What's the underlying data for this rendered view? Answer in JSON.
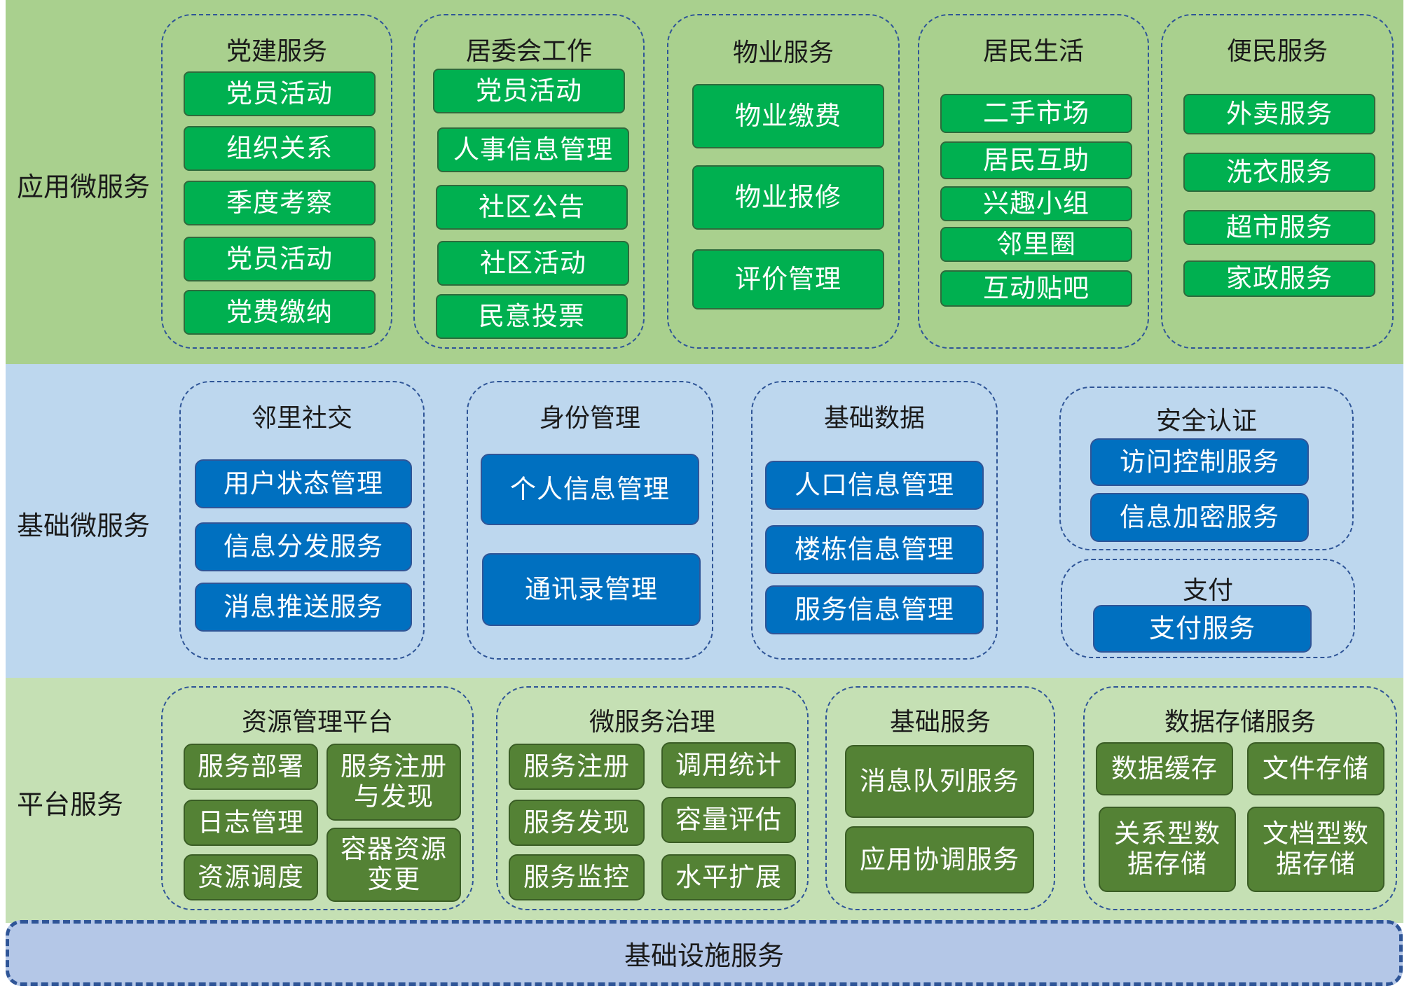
{
  "layers": {
    "app": "应用微服务",
    "base": "基础微服务",
    "platform": "平台服务",
    "infra": "基础设施服务"
  },
  "app_groups": [
    {
      "title": "党建服务",
      "items": [
        "党员活动",
        "组织关系",
        "季度考察",
        "党员活动",
        "党费缴纳"
      ]
    },
    {
      "title": "居委会工作",
      "items": [
        "党员活动",
        "人事信息管理",
        "社区公告",
        "社区活动",
        "民意投票"
      ]
    },
    {
      "title": "物业服务",
      "items": [
        "物业缴费",
        "物业报修",
        "评价管理"
      ]
    },
    {
      "title": "居民生活",
      "items": [
        "二手市场",
        "居民互助",
        "兴趣小组",
        "邻里圈",
        "互动贴吧"
      ]
    },
    {
      "title": "便民服务",
      "items": [
        "外卖服务",
        "洗衣服务",
        "超市服务",
        "家政服务"
      ]
    }
  ],
  "base_groups": [
    {
      "title": "邻里社交",
      "items": [
        "用户状态管理",
        "信息分发服务",
        "消息推送服务"
      ]
    },
    {
      "title": "身份管理",
      "items": [
        "个人信息管理",
        "通讯录管理"
      ]
    },
    {
      "title": "基础数据",
      "items": [
        "人口信息管理",
        "楼栋信息管理",
        "服务信息管理"
      ]
    },
    {
      "title": "安全认证",
      "items": [
        "访问控制服务",
        "信息加密服务"
      ]
    },
    {
      "title": "支付",
      "items": [
        "支付服务"
      ]
    }
  ],
  "platform_groups": [
    {
      "title": "资源管理平台",
      "items": [
        "服务部署",
        "日志管理",
        "资源调度",
        "服务注册\n与发现",
        "容器资源\n变更"
      ]
    },
    {
      "title": "微服务治理",
      "items": [
        "服务注册",
        "服务发现",
        "服务监控",
        "调用统计",
        "容量评估",
        "水平扩展"
      ]
    },
    {
      "title": "基础服务",
      "items": [
        "消息队列服务",
        "应用协调服务"
      ]
    },
    {
      "title": "数据存储服务",
      "items": [
        "数据缓存",
        "文件存储",
        "关系型数\n据存储",
        "文档型数\n据存储"
      ]
    }
  ],
  "colors": {
    "app_band": "#a9d08e",
    "base_band": "#bdd7ee",
    "platform_band": "#c5e0b4",
    "infra_band": "#b4c7e7",
    "app_button": "#00b050",
    "base_button": "#0070c0",
    "platform_button": "#548235",
    "dashed_border": "#2f5597"
  }
}
